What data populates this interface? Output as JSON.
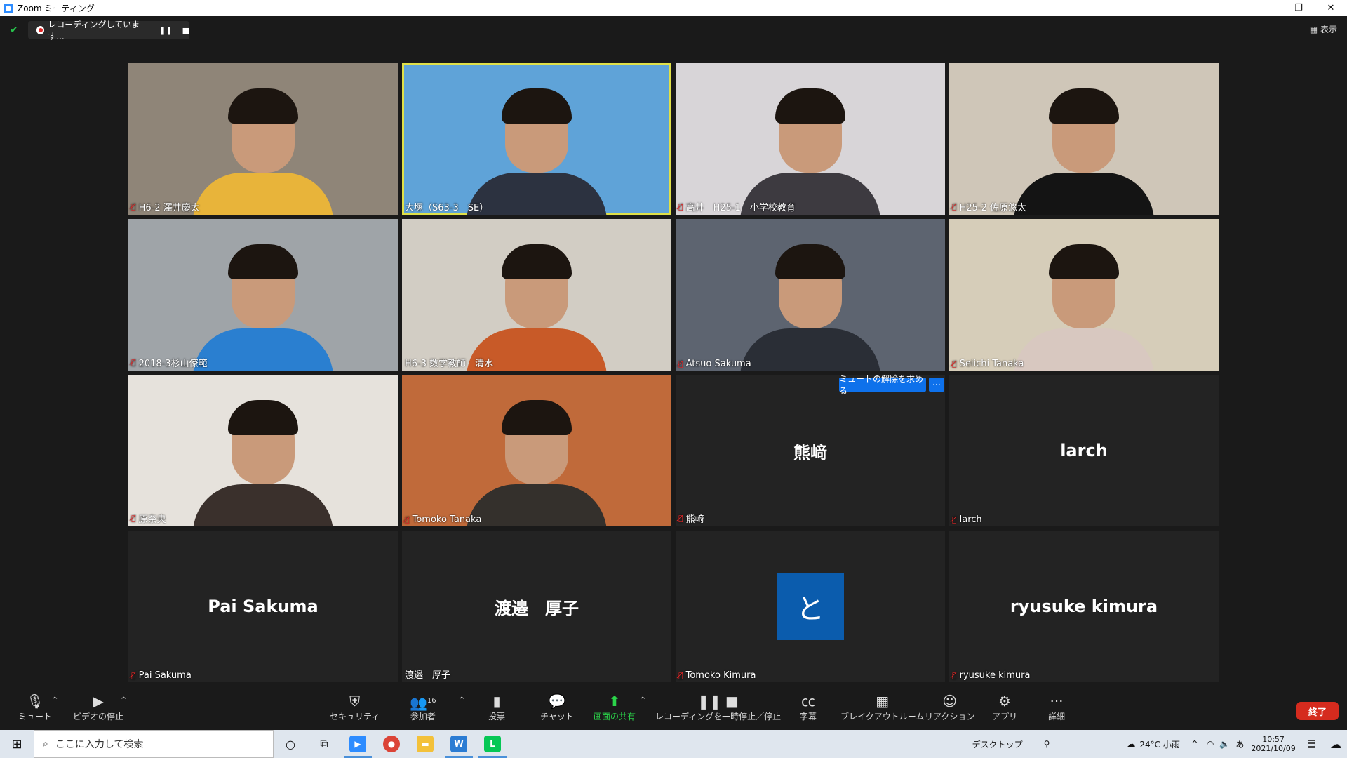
{
  "window": {
    "title": "Zoom ミーティング",
    "controls": [
      "–",
      "❐",
      "✕"
    ]
  },
  "recording": {
    "status": "レコーディングしています...",
    "pause_icon": "pause-icon",
    "stop_icon": "stop-icon"
  },
  "view_button": "▦ 表示",
  "participants": [
    {
      "name": "H6-2 澤井慶太",
      "muted": true,
      "video": true,
      "shirt": "#e8b43a",
      "bg": "#8f8578"
    },
    {
      "name": "大塚（S63-3　SE）",
      "muted": false,
      "video": true,
      "shirt": "#2c3240",
      "bg": "#5fa3d8",
      "active": true
    },
    {
      "name": "高井　H25-1　小学校教育",
      "muted": true,
      "video": true,
      "shirt": "#3d3a40",
      "bg": "#d8d5d8"
    },
    {
      "name": "H25-2  佐原悠太",
      "muted": true,
      "video": true,
      "shirt": "#141414",
      "bg": "#cfc6b8"
    },
    {
      "name": "2018-3杉山僚範",
      "muted": true,
      "video": true,
      "shirt": "#2a7fd0",
      "bg": "#9fa4a8"
    },
    {
      "name": "H6-3 数学教師　清水",
      "muted": false,
      "video": true,
      "shirt": "#c85a28",
      "bg": "#d2cdc4"
    },
    {
      "name": "Atsuo Sakuma",
      "muted": true,
      "video": true,
      "shirt": "#2a2e36",
      "bg": "#5d6470"
    },
    {
      "name": "Seiichi Tanaka",
      "muted": true,
      "video": true,
      "shirt": "#d8c8c0",
      "bg": "#d6cdb9"
    },
    {
      "name": "原奈央",
      "muted": true,
      "video": true,
      "shirt": "#3a302c",
      "bg": "#e6e2dc"
    },
    {
      "name": "Tomoko Tanaka",
      "muted": true,
      "video": true,
      "shirt": "#34302c",
      "bg": "#c06a3a"
    },
    {
      "name": "熊﨑",
      "muted": true,
      "video": false,
      "display": "熊﨑"
    },
    {
      "name": "larch",
      "muted": true,
      "video": false,
      "display": "larch"
    },
    {
      "name": "Pai Sakuma",
      "muted": true,
      "video": false,
      "display": "Pai Sakuma"
    },
    {
      "name": "渡邉　厚子",
      "muted": false,
      "video": false,
      "display": "渡邉　厚子"
    },
    {
      "name": "Tomoko Kimura",
      "muted": true,
      "video": false,
      "display": "と",
      "avatar": true
    },
    {
      "name": "ryusuke kimura",
      "muted": true,
      "video": false,
      "display": "ryusuke kimura"
    }
  ],
  "tile_actions": {
    "ask_unmute": "ミュートの解除を求める",
    "more": "···"
  },
  "toolbar": {
    "mute": {
      "icon": "microphone-icon",
      "label": "ミュート"
    },
    "video": {
      "icon": "camera-icon",
      "label": "ビデオの停止"
    },
    "security": {
      "icon": "shield-icon",
      "label": "セキュリティ"
    },
    "participants": {
      "icon": "people-icon",
      "label": "参加者",
      "count": "16"
    },
    "poll": {
      "icon": "bar-chart-icon",
      "label": "投票"
    },
    "chat": {
      "icon": "chat-icon",
      "label": "チャット"
    },
    "share": {
      "icon": "share-up-icon",
      "label": "画面の共有",
      "color": "#2bd44a"
    },
    "recording": {
      "icon": "pause-stop-icon",
      "label": "レコーディングを一時停止／停止"
    },
    "captions": {
      "icon": "cc-icon",
      "label": "字幕"
    },
    "breakout": {
      "icon": "grid-icon",
      "label": "ブレイクアウトルーム"
    },
    "reactions": {
      "icon": "emoji-icon",
      "label": "リアクション"
    },
    "apps": {
      "icon": "apps-icon",
      "label": "アプリ"
    },
    "more": {
      "icon": "ellipsis-icon",
      "label": "詳細"
    },
    "end": "終了"
  },
  "taskbar": {
    "search_placeholder": "ここに入力して検索",
    "desktop": "デスクトップ",
    "weather": "24°C  小雨",
    "ime": "あ",
    "time": "10:57",
    "date": "2021/10/09"
  }
}
